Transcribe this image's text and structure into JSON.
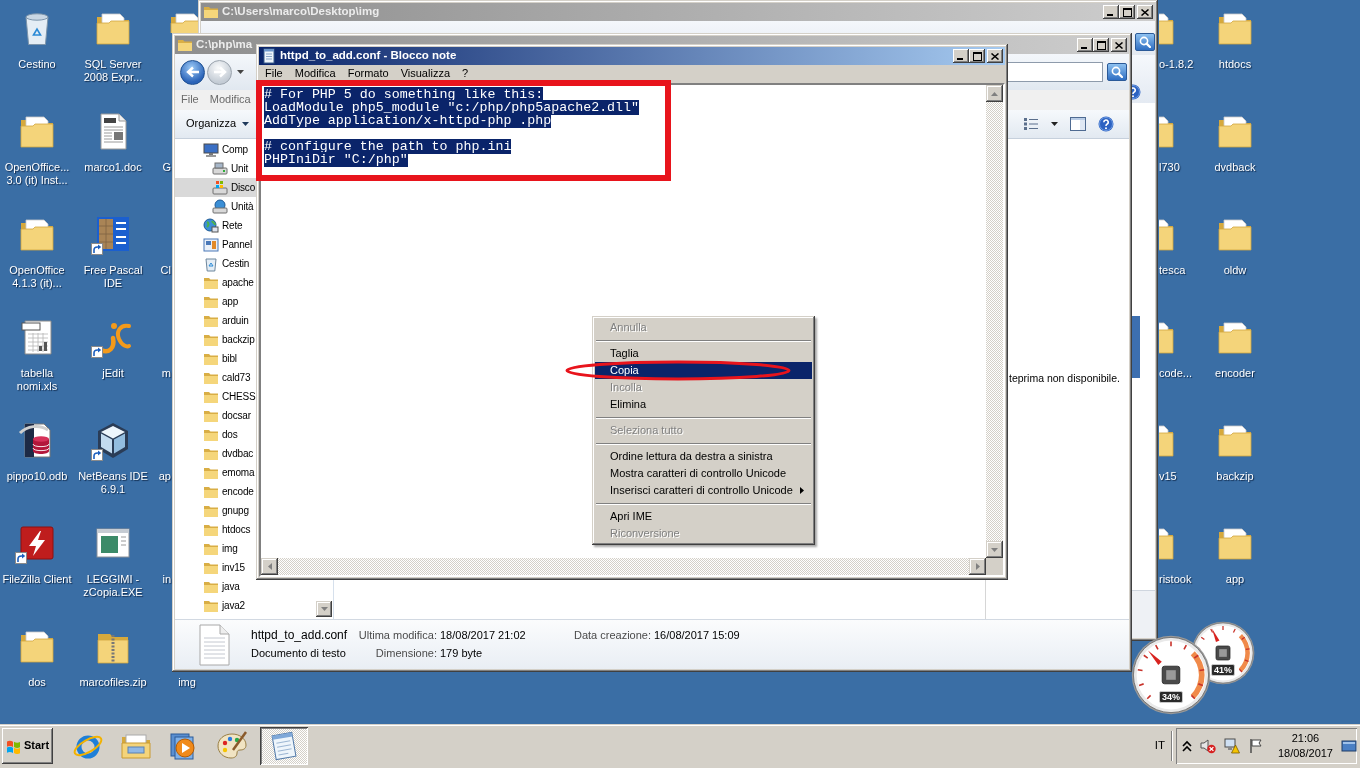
{
  "desktop": {
    "columns": [
      [
        {
          "label": "Cestino",
          "kind": "bin",
          "shortcut": false
        },
        {
          "label": "OpenOffice... 3.0 (it) Inst...",
          "kind": "folder",
          "shortcut": false
        },
        {
          "label": "OpenOffice 4.1.3 (it)...",
          "kind": "folder",
          "shortcut": false
        },
        {
          "label": "tabella nomi.xls",
          "kind": "spreadsheet",
          "shortcut": false
        },
        {
          "label": "pippo10.odb",
          "kind": "database",
          "shortcut": false
        },
        {
          "label": "FileZilla Client",
          "kind": "filezilla",
          "shortcut": true
        },
        {
          "label": "dos",
          "kind": "folder",
          "shortcut": false
        }
      ],
      [
        {
          "label": "SQL Server 2008 Expr...",
          "kind": "folder",
          "shortcut": false
        },
        {
          "label": "marco1.doc",
          "kind": "document",
          "shortcut": false
        },
        {
          "label": "Free Pascal IDE",
          "kind": "pascal",
          "shortcut": true
        },
        {
          "label": "jEdit",
          "kind": "jedit",
          "shortcut": true
        },
        {
          "label": "NetBeans IDE 6.9.1",
          "kind": "netbeans",
          "shortcut": true
        },
        {
          "label": "LEGGIMI - zCopia.EXE",
          "kind": "program",
          "shortcut": false
        },
        {
          "label": "marcofiles.zip",
          "kind": "zip",
          "shortcut": false
        }
      ],
      [
        {
          "kind": "folder",
          "shortcut": false
        },
        {
          "label": "G"
        },
        {
          "label": "Cl"
        },
        {
          "label": "m"
        },
        {
          "label": "ap"
        },
        {
          "label": "in"
        },
        {
          "label": "img"
        }
      ],
      [
        {
          "label": "o-1.8.2",
          "kind": "folder",
          "shortcut": false
        },
        {
          "label": "l730",
          "kind": "folder",
          "shortcut": false
        },
        {
          "label": "tesca",
          "kind": "folder",
          "shortcut": false
        },
        {
          "label": "code...",
          "kind": "folder",
          "shortcut": false
        },
        {
          "label": "v15",
          "kind": "folder",
          "shortcut": false
        },
        {
          "label": "ristook",
          "kind": "folder",
          "shortcut": false
        }
      ],
      [
        {
          "label": "htdocs",
          "kind": "folder",
          "shortcut": false
        },
        {
          "label": "dvdback",
          "kind": "folder",
          "shortcut": false
        },
        {
          "label": "oldw",
          "kind": "folder",
          "shortcut": false
        },
        {
          "label": "encoder",
          "kind": "folder",
          "shortcut": false
        },
        {
          "label": "backzip",
          "kind": "folder",
          "shortcut": false
        },
        {
          "label": "app",
          "kind": "folder",
          "shortcut": false
        }
      ]
    ]
  },
  "img_window": {
    "title": "C:\\Users\\marco\\Desktop\\img",
    "active": false
  },
  "explorer_window": {
    "title": "C:\\php\\ma",
    "active": false,
    "menu": [
      "File",
      "Modifica"
    ],
    "organize": "Organizza",
    "nav_tree": [
      {
        "label": "Comp",
        "kind": "computer",
        "selected": false,
        "children": [
          {
            "label": "Unit",
            "kind": "drive",
            "selected": false
          },
          {
            "label": "Disco",
            "kind": "system_drive",
            "selected": true
          },
          {
            "label": "Unità",
            "kind": "network_drive",
            "selected": false
          }
        ]
      },
      {
        "label": "Rete",
        "kind": "network",
        "selected": false
      },
      {
        "label": "Pannel",
        "kind": "control_panel",
        "selected": false
      },
      {
        "label": "Cestin",
        "kind": "bin",
        "selected": false
      },
      {
        "label": "apache",
        "kind": "folder",
        "selected": false
      },
      {
        "label": "app",
        "kind": "folder",
        "selected": false
      },
      {
        "label": "arduin",
        "kind": "folder",
        "selected": false
      },
      {
        "label": "backzip",
        "kind": "folder",
        "selected": false
      },
      {
        "label": "bibl",
        "kind": "folder",
        "selected": false
      },
      {
        "label": "cald73",
        "kind": "folder",
        "selected": false
      },
      {
        "label": "CHESS",
        "kind": "folder",
        "selected": false
      },
      {
        "label": "docsar",
        "kind": "folder",
        "selected": false
      },
      {
        "label": "dos",
        "kind": "folder",
        "selected": false
      },
      {
        "label": "dvdbac",
        "kind": "folder",
        "selected": false
      },
      {
        "label": "emoma",
        "kind": "folder",
        "selected": false
      },
      {
        "label": "encode",
        "kind": "folder",
        "selected": false
      },
      {
        "label": "gnupg",
        "kind": "folder",
        "selected": false
      },
      {
        "label": "htdocs",
        "kind": "folder",
        "selected": false
      },
      {
        "label": "img",
        "kind": "folder",
        "selected": false
      },
      {
        "label": "inv15",
        "kind": "folder",
        "selected": false
      },
      {
        "label": "java",
        "kind": "folder",
        "selected": false
      },
      {
        "label": "java2",
        "kind": "folder",
        "selected": false
      }
    ],
    "preview_message": "teprima non disponibile.",
    "details": {
      "rows": [
        {
          "main": "httpd_to_add.conf",
          "fields": [
            {
              "label": "Ultima modifica:",
              "value": "18/08/2017 21:02"
            },
            {
              "label": "Data creazione:",
              "value": "16/08/2017 15:09"
            }
          ]
        },
        {
          "main": "Documento di testo",
          "fields": [
            {
              "label": "Dimensione:",
              "value": "179 byte"
            }
          ]
        }
      ]
    }
  },
  "notepad": {
    "title": "httpd_to_add.conf - Blocco note",
    "active": true,
    "menu": [
      "File",
      "Modifica",
      "Formato",
      "Visualizza",
      "?"
    ],
    "text_blocks": [
      [
        "# For PHP 5 do something like this:",
        "LoadModule php5_module \"c:/php/php5apache2.dll\"",
        "AddType application/x-httpd-php .php"
      ],
      [
        "# configure the path to php.ini",
        "PHPIniDir \"C:/php\""
      ]
    ],
    "text_selected": true
  },
  "context_menu": {
    "items": [
      {
        "kind": "item",
        "label": "Annulla",
        "disabled": true,
        "selected": false
      },
      {
        "kind": "separator"
      },
      {
        "kind": "item",
        "label": "Taglia",
        "disabled": false,
        "selected": false
      },
      {
        "kind": "item",
        "label": "Copia",
        "disabled": false,
        "selected": true
      },
      {
        "kind": "item",
        "label": "Incolla",
        "disabled": true,
        "selected": false
      },
      {
        "kind": "item",
        "label": "Elimina",
        "disabled": false,
        "selected": false
      },
      {
        "kind": "separator"
      },
      {
        "kind": "item",
        "label": "Seleziona tutto",
        "disabled": true,
        "selected": false
      },
      {
        "kind": "separator"
      },
      {
        "kind": "item",
        "label": "Ordine lettura da destra a sinistra",
        "disabled": false,
        "selected": false
      },
      {
        "kind": "item",
        "label": "Mostra caratteri di controllo Unicode",
        "disabled": false,
        "selected": false
      },
      {
        "kind": "submenu",
        "label": "Inserisci caratteri di controllo Unicode",
        "disabled": false,
        "selected": false
      },
      {
        "kind": "separator"
      },
      {
        "kind": "item",
        "label": "Apri IME",
        "disabled": false,
        "selected": false
      },
      {
        "kind": "item",
        "label": "Riconversione",
        "disabled": true,
        "selected": false
      }
    ]
  },
  "annotations": [
    {
      "kind": "rectangle"
    },
    {
      "kind": "ellipse"
    }
  ],
  "cpu_meter": {
    "meters": [
      {
        "reading": "41%",
        "level": 0.41
      },
      {
        "reading": "34%",
        "level": 0.34
      }
    ]
  },
  "taskbar": {
    "start_label": "Start",
    "quick_launch": [
      {
        "kind": "browser"
      },
      {
        "kind": "explorer"
      },
      {
        "kind": "media"
      },
      {
        "kind": "paint"
      }
    ],
    "tasks": [
      {
        "kind": "notepad",
        "selected": true
      }
    ],
    "language": "IT",
    "tray": [
      {
        "kind": "chevron"
      },
      {
        "kind": "volume_muted"
      },
      {
        "kind": "network_warning"
      },
      {
        "kind": "action_flag"
      }
    ],
    "time": "21:06",
    "date": "18/08/2017"
  }
}
